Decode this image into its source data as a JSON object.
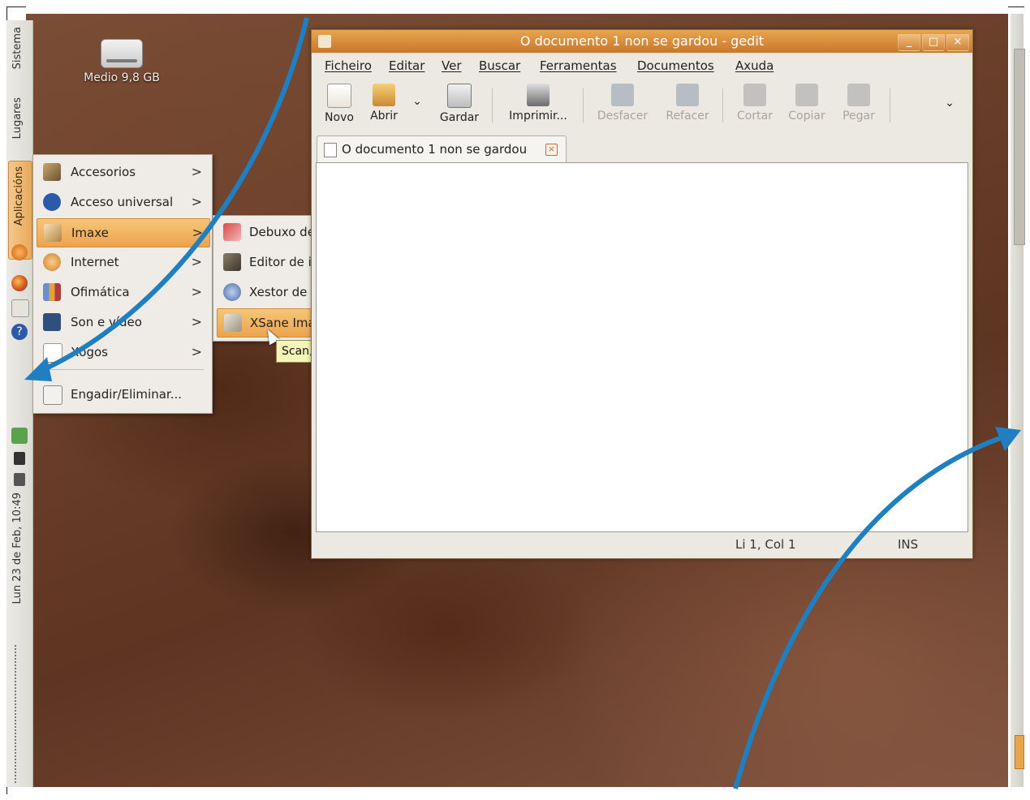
{
  "desktop": {
    "drive_label": "Medio 9,8 GB"
  },
  "panel": {
    "sistema": "Sistema",
    "lugares": "Lugares",
    "aplicacions": "Aplicacións",
    "clock": "Lun 23 de Feb, 10:49"
  },
  "menu": {
    "items": [
      {
        "label": "Accesorios",
        "icon": "accessories-icon"
      },
      {
        "label": "Acceso universal",
        "icon": "accessibility-icon"
      },
      {
        "label": "Imaxe",
        "icon": "graphics-icon"
      },
      {
        "label": "Internet",
        "icon": "internet-icon"
      },
      {
        "label": "Ofimática",
        "icon": "office-icon"
      },
      {
        "label": "Son e vídeo",
        "icon": "multimedia-icon"
      },
      {
        "label": "Xogos",
        "icon": "games-icon"
      }
    ],
    "add_remove": "Engadir/Eliminar...",
    "selected": "Imaxe"
  },
  "submenu": {
    "items": [
      {
        "label": "Debuxo de OpenOffice.org",
        "icon": "draw-icon"
      },
      {
        "label": "Editor de imaxes GIMP",
        "icon": "gimp-icon"
      },
      {
        "label": "Xestor de fotos F-Spot",
        "icon": "fspot-icon"
      },
      {
        "label": "XSane Image Scanner",
        "icon": "scanner-icon"
      }
    ],
    "selected": "XSane Image Scanner",
    "tooltip": "Scan, copy and fax images"
  },
  "window": {
    "title": "O documento 1 non se gardou - gedit",
    "menubar": [
      "Ficheiro",
      "Editar",
      "Ver",
      "Buscar",
      "Ferramentas",
      "Documentos",
      "Axuda"
    ],
    "toolbar": {
      "new": "Novo",
      "open": "Abrir",
      "save": "Gardar",
      "print": "Imprimir...",
      "undo": "Desfacer",
      "redo": "Refacer",
      "cut": "Cortar",
      "copy": "Copiar",
      "paste": "Pegar"
    },
    "tab_label": "O documento 1 non se gardou",
    "status": {
      "position": "Li 1, Col 1",
      "mode": "INS"
    }
  },
  "colors": {
    "accent": "#e8a54e",
    "arrow": "#1f7fc1",
    "wallpaper": "#6a3f2a"
  }
}
